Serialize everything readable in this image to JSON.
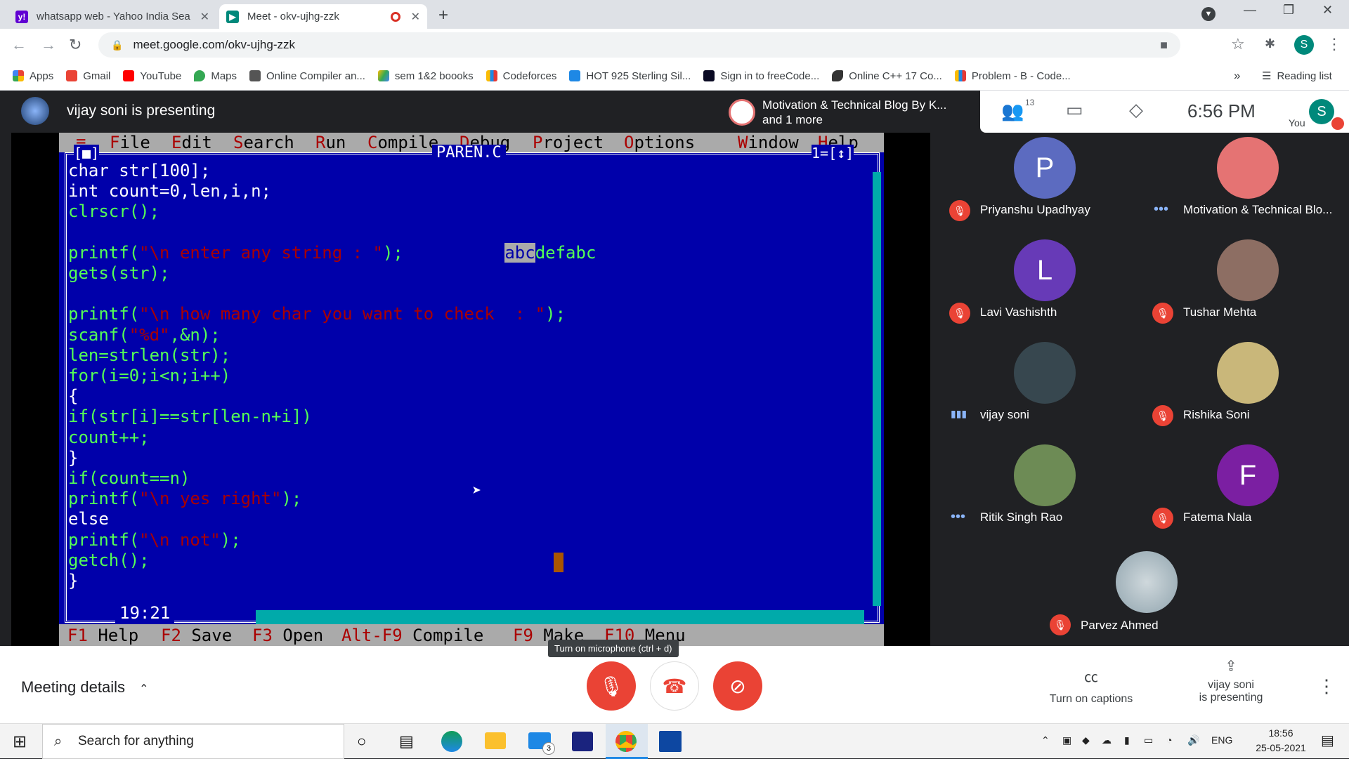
{
  "browser": {
    "tabs": [
      {
        "title": "whatsapp web - Yahoo India Sea",
        "icon": "yahoo-icon"
      },
      {
        "title": "Meet - okv-ujhg-zzk",
        "icon": "meet-icon",
        "recording": true
      }
    ],
    "url": "meet.google.com/okv-ujhg-zzk",
    "profile_letter": "S",
    "bookmarks": [
      "Apps",
      "Gmail",
      "YouTube",
      "Maps",
      "Online Compiler an...",
      "sem 1&2 boooks",
      "Codeforces",
      "HOT 925 Sterling Sil...",
      "Sign in to freeCode...",
      "Online C++ 17 Co...",
      "Problem - B - Code..."
    ],
    "reading_list": "Reading list",
    "more": "»"
  },
  "meet": {
    "presenting_title": "vijay soni is presenting",
    "pinned_chip": {
      "line1": "Motivation & Technical Blog By K...",
      "line2": "and 1 more"
    },
    "people_count": "13",
    "clock": "6:56 PM",
    "you_label": "You",
    "you_letter": "S",
    "participants": [
      {
        "name": "Priyanshu Upadhyay",
        "letter": "P",
        "color": "#5c6bc0",
        "status": "muted"
      },
      {
        "name": "Motivation & Technical Blo...",
        "letter": "",
        "color": "#e57373",
        "status": "dots"
      },
      {
        "name": "Lavi Vashishth",
        "letter": "L",
        "color": "#673ab7",
        "status": "muted"
      },
      {
        "name": "Tushar Mehta",
        "letter": "",
        "color": "#8d6e63",
        "status": "muted"
      },
      {
        "name": "vijay soni",
        "letter": "",
        "color": "#37474f",
        "status": "speaking"
      },
      {
        "name": "Rishika Soni",
        "letter": "",
        "color": "#c9b77a",
        "status": "muted"
      },
      {
        "name": "Ritik Singh Rao",
        "letter": "",
        "color": "#6d8b55",
        "status": "dots"
      },
      {
        "name": "Fatema Nala",
        "letter": "F",
        "color": "#7b1fa2",
        "status": "muted"
      },
      {
        "name": "Parvez Ahmed",
        "letter": "",
        "color": "#90a4ae",
        "status": "muted"
      }
    ],
    "meeting_details": "Meeting details",
    "tooltip": "Turn on microphone (ctrl + d)",
    "captions": "Turn on captions",
    "presenting_bottom": [
      "vijay soni",
      "is presenting"
    ]
  },
  "dos": {
    "menu": [
      {
        "hot": "≡",
        "rest": ""
      },
      {
        "hot": "F",
        "rest": "ile"
      },
      {
        "hot": "E",
        "rest": "dit"
      },
      {
        "hot": "S",
        "rest": "earch"
      },
      {
        "hot": "R",
        "rest": "un"
      },
      {
        "hot": "C",
        "rest": "ompile"
      },
      {
        "hot": "D",
        "rest": "ebug"
      },
      {
        "hot": "P",
        "rest": "roject"
      },
      {
        "hot": "O",
        "rest": "ptions"
      },
      {
        "hot": "W",
        "rest": "indow"
      },
      {
        "hot": "H",
        "rest": "elp"
      }
    ],
    "frame_left": "[■]",
    "file_title": "PAREN.C",
    "frame_right": "1=[↕]",
    "code": [
      [
        {
          "t": "char str[100];",
          "c": "w"
        }
      ],
      [
        {
          "t": "int count=0,len,i,n;",
          "c": "w"
        }
      ],
      [
        {
          "t": "clrscr();",
          "c": "g"
        }
      ],
      [
        {
          "t": "",
          "c": "w"
        }
      ],
      [
        {
          "t": "printf(",
          "c": "g"
        },
        {
          "t": "\"\\n enter any string : \"",
          "c": "r"
        },
        {
          "t": ");",
          "c": "g"
        },
        {
          "t": "          ",
          "c": "w"
        },
        {
          "t": "abc",
          "c": "sel"
        },
        {
          "t": "defabc",
          "c": "g"
        }
      ],
      [
        {
          "t": "gets(str);",
          "c": "g"
        }
      ],
      [
        {
          "t": "",
          "c": "w"
        }
      ],
      [
        {
          "t": "printf(",
          "c": "g"
        },
        {
          "t": "\"\\n how many char you want to check  : \"",
          "c": "r"
        },
        {
          "t": ");",
          "c": "g"
        }
      ],
      [
        {
          "t": "scanf(",
          "c": "g"
        },
        {
          "t": "\"%d\"",
          "c": "r"
        },
        {
          "t": ",&n);",
          "c": "g"
        }
      ],
      [
        {
          "t": "len=strlen(str);",
          "c": "g"
        }
      ],
      [
        {
          "t": "for(i=0;i<n;i++)",
          "c": "g"
        }
      ],
      [
        {
          "t": "{",
          "c": "w"
        }
      ],
      [
        {
          "t": "if(str[i]==str[len-n+i])",
          "c": "g"
        }
      ],
      [
        {
          "t": "count++;",
          "c": "g"
        }
      ],
      [
        {
          "t": "}",
          "c": "w"
        }
      ],
      [
        {
          "t": "if(count==n)",
          "c": "g"
        }
      ],
      [
        {
          "t": "printf(",
          "c": "g"
        },
        {
          "t": "\"\\n yes right\"",
          "c": "r"
        },
        {
          "t": ");",
          "c": "g"
        }
      ],
      [
        {
          "t": "else",
          "c": "w"
        }
      ],
      [
        {
          "t": "printf(",
          "c": "g"
        },
        {
          "t": "\"\\n not\"",
          "c": "r"
        },
        {
          "t": ");",
          "c": "g"
        }
      ],
      [
        {
          "t": "getch();",
          "c": "g"
        }
      ],
      [
        {
          "t": "}",
          "c": "w"
        }
      ]
    ],
    "position": "19:21",
    "status": [
      {
        "key": "F1",
        "label": "Help"
      },
      {
        "key": "F2",
        "label": "Save"
      },
      {
        "key": "F3",
        "label": "Open"
      },
      {
        "key": "Alt-F9",
        "label": "Compile"
      },
      {
        "key": "F9",
        "label": "Make"
      },
      {
        "key": "F10",
        "label": "Menu"
      }
    ]
  },
  "taskbar": {
    "search_placeholder": "Search for anything",
    "mail_badge": "3",
    "lang": "ENG",
    "time": "18:56",
    "date": "25-05-2021"
  },
  "colors": {
    "mic_off": "#ea4335",
    "dos_blue": "#0000aa",
    "dos_menu": "#aaaaaa"
  }
}
